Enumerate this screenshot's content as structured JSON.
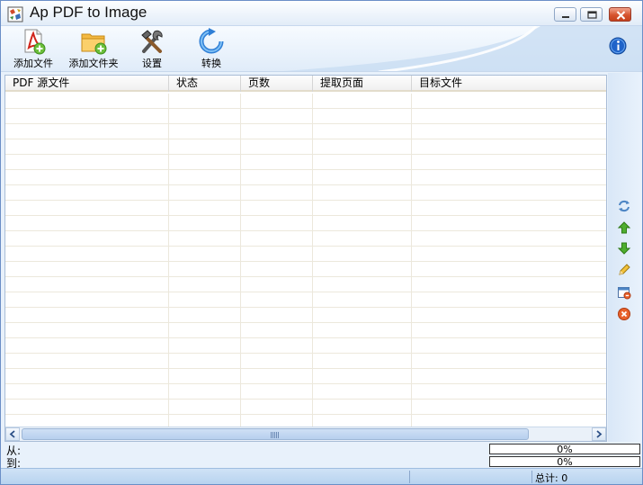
{
  "window": {
    "title": "Ap PDF to Image"
  },
  "toolbar": {
    "add_file": "添加文件",
    "add_folder": "添加文件夹",
    "settings": "设置",
    "convert": "转换"
  },
  "table": {
    "columns": [
      "PDF 源文件",
      "状态",
      "页数",
      "提取页面",
      "目标文件"
    ],
    "rows": []
  },
  "sidebar_icons": [
    "refresh-icon",
    "move-up-icon",
    "move-down-icon",
    "edit-icon",
    "clear-list-icon",
    "remove-icon"
  ],
  "status": {
    "from_label": "从:",
    "to_label": "到:",
    "progress_from": "0%",
    "progress_to": "0%",
    "total": "总计: 0"
  },
  "colors": {
    "accent": "#3a7fd5",
    "window_bg": "#e8f1fb",
    "grid_line": "#ece8dc"
  }
}
